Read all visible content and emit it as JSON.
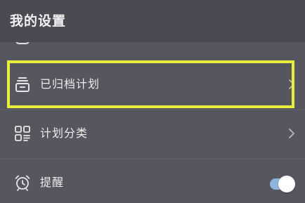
{
  "header": {
    "title": "我的设置"
  },
  "settings": {
    "items": [
      {
        "label": "已归档计划",
        "icon": "archive-box-icon",
        "control": "chevron",
        "highlighted": true
      },
      {
        "label": "计划分类",
        "icon": "category-grid-icon",
        "control": "chevron",
        "highlighted": false
      },
      {
        "label": "提醒",
        "icon": "alarm-clock-icon",
        "control": "toggle",
        "toggle_on": true
      }
    ]
  },
  "colors": {
    "background": "#56565f",
    "header": "#4a4a52",
    "highlight_border": "#e8ef3a",
    "toggle_track": "#8fb4dd"
  }
}
